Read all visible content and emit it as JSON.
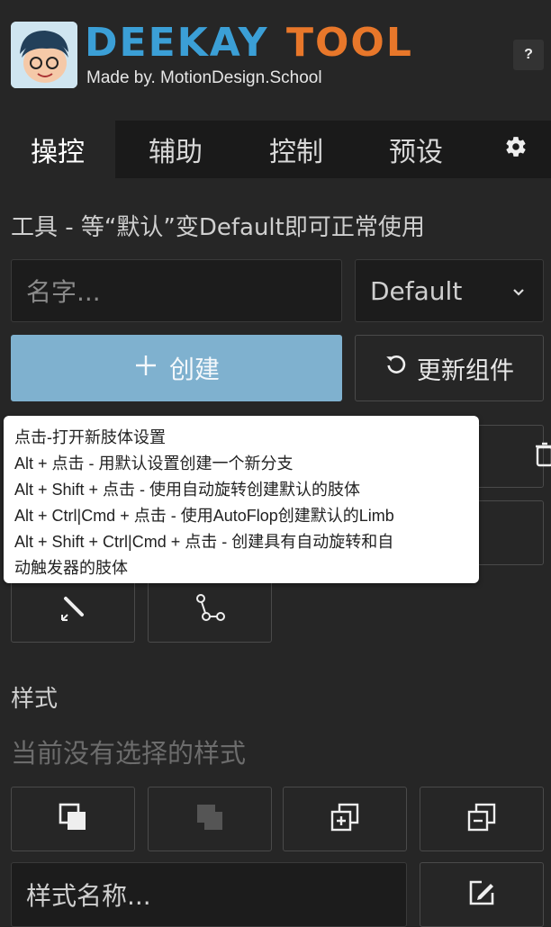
{
  "header": {
    "logo_left": "DEEKAY",
    "logo_right": "TOOL",
    "subtitle": "Made by. MotionDesign.School",
    "help_label": "?"
  },
  "tabs": [
    {
      "label": "操控",
      "active": true
    },
    {
      "label": "辅助",
      "active": false
    },
    {
      "label": "控制",
      "active": false
    },
    {
      "label": "预设",
      "active": false
    }
  ],
  "tools": {
    "heading": "工具 - 等“默认”变Default即可正常使用",
    "name_placeholder": "名字...",
    "preset_value": "Default",
    "create_label": "创建",
    "update_label": "更新组件"
  },
  "tooltip": {
    "lines": [
      "点击-打开新肢体设置",
      "Alt + 点击 - 用默认设置创建一个新分支",
      "Alt + Shift + 点击 - 使用自动旋转创建默认的肢体",
      "Alt + Ctrl|Cmd + 点击 - 使用AutoFlop创建默认的Limb",
      "Alt + Shift + Ctrl|Cmd + 点击 - 创建具有自动旋转和自",
      "动触发器的肢体"
    ]
  },
  "styles": {
    "heading": "样式",
    "empty_text": "当前没有选择的样式",
    "name_placeholder": "样式名称..."
  },
  "icons": {
    "settings": "gear-icon",
    "create": "plus-icon",
    "update": "refresh-icon"
  },
  "colors": {
    "primary_button": "#7fb1cf",
    "logo_blue": "#3b9fd6",
    "logo_orange": "#e8772a"
  }
}
